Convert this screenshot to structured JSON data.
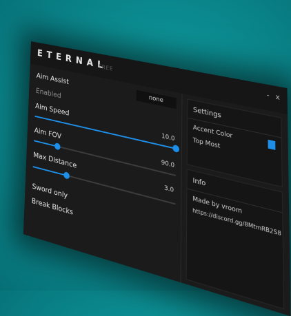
{
  "window": {
    "title": "ETERNAL",
    "subtitle": "FREE",
    "minimize": "-",
    "close": "x"
  },
  "left": {
    "aim_assist": "Aim Assist",
    "mode_value": "none",
    "enabled": "Enabled",
    "aim_speed": {
      "label": "Aim Speed",
      "value": "10.0",
      "fraction": 1.0
    },
    "aim_fov": {
      "label": "Aim FOV",
      "value": "90.0",
      "fraction": 0.18
    },
    "max_distance": {
      "label": "Max Distance",
      "value": "3.0",
      "fraction": 0.25
    },
    "sword_only": "Sword only",
    "break_blocks": "Break Blocks"
  },
  "settings": {
    "title": "Settings",
    "accent_color_label": "Accent Color",
    "accent_color": "#1e8fe8",
    "top_most": "Top Most"
  },
  "info": {
    "title": "Info",
    "made_by": "Made by vroom",
    "link": "https://discord.gg/8MtmRB2S8"
  }
}
